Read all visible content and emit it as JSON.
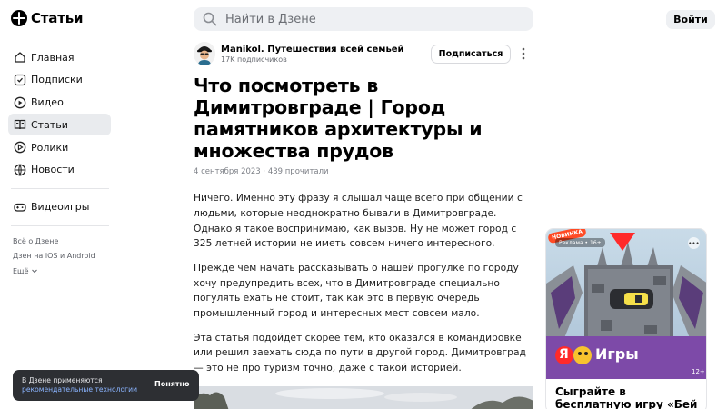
{
  "header": {
    "logo_text": "Статьи",
    "search_placeholder": "Найти в Дзене",
    "login_label": "Войти"
  },
  "sidebar": {
    "items": [
      {
        "label": "Главная",
        "icon": "home-icon",
        "active": false
      },
      {
        "label": "Подписки",
        "icon": "subscriptions-icon",
        "active": false
      },
      {
        "label": "Видео",
        "icon": "video-icon",
        "active": false
      },
      {
        "label": "Статьи",
        "icon": "articles-icon",
        "active": true
      },
      {
        "label": "Ролики",
        "icon": "clips-icon",
        "active": false
      },
      {
        "label": "Новости",
        "icon": "news-icon",
        "active": false
      }
    ],
    "games": {
      "label": "Видеоигры",
      "icon": "gamepad-icon"
    },
    "links": [
      "Всё о Дзене",
      "Дзен на iOS и Android",
      "Ещё"
    ]
  },
  "article": {
    "author_name": "Manikol. Путешествия всей семьей",
    "author_subscribers": "17K подписчиков",
    "subscribe_label": "Подписаться",
    "title": "Что посмотреть в Димитровграде | Город памятников архитектуры и множества прудов",
    "meta": "4 сентября 2023 · 439 прочитали",
    "paragraphs": [
      "Ничего. Именно эту фразу я слышал чаще всего при общении с людьми, которые неоднократно бывали в Димитровграде. Однако я такое воспринимаю, как вызов. Ну не может город с 325 летней истории не иметь совсем ничего интересного.",
      "Прежде чем начать рассказывать о нашей прогулке по городу хочу предупредить всех, что в Димитровграде специально погулять ехать не стоит, так как это в первую очередь промышленный город и интересных мест совсем мало.",
      "Эта статья подойдет скорее тем, кто оказался в командировке или решил заехать сюда по пути в другой город. Димитровград — это не про туризм точно, даже с такой историей."
    ]
  },
  "cookie_banner": {
    "text": "В Дзене применяются",
    "link": "рекомендательные технологии",
    "button": "Понятно"
  },
  "ad": {
    "badge": "НОВИНКА",
    "label": "Реклама • 16+",
    "menu": "•••",
    "logo_letter": "Я",
    "logo_text": "Игры",
    "age": "12+",
    "title": "Сыграйте в бесплатную игру «Бей Монстра»"
  },
  "colors": {
    "accent_active_bg": "#e9ebee",
    "search_bg": "#eef0f3",
    "cookie_bg": "#2d2f33",
    "ad_game_bg": "#7d4aa8",
    "ad_badge": "#ff4b25"
  }
}
